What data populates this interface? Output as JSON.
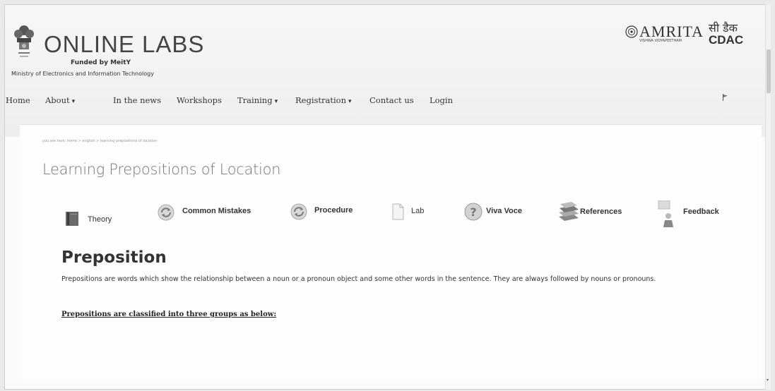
{
  "brand": {
    "title": "ONLINE LABS",
    "funded_by": "Funded by MeitY",
    "ministry": "Ministry of Electronics and Information Technology"
  },
  "partners": {
    "amrita_name": "AMRITA",
    "amrita_sub": "VISHWA VIDYAPEETHAM",
    "cdac_hindi": "सी डैक",
    "cdac_name": "CDAC"
  },
  "nav": [
    {
      "label": "Home",
      "dropdown": false
    },
    {
      "label": "About",
      "dropdown": true
    },
    {
      "label": "In the news",
      "dropdown": false
    },
    {
      "label": "Workshops",
      "dropdown": false
    },
    {
      "label": "Training",
      "dropdown": true
    },
    {
      "label": "Registration",
      "dropdown": true
    },
    {
      "label": "Contact us",
      "dropdown": false
    },
    {
      "label": "Login",
      "dropdown": false
    }
  ],
  "breadcrumb": "you are here: home > english > learning prepositions of location",
  "page_title": "Learning Prepositions of Location",
  "tabs": [
    {
      "label": "Theory",
      "icon": "book-icon"
    },
    {
      "label": "Common Mistakes",
      "icon": "refresh-icon"
    },
    {
      "label": "Procedure",
      "icon": "refresh-icon"
    },
    {
      "label": "Lab",
      "icon": "document-icon"
    },
    {
      "label": "Viva Voce",
      "icon": "question-icon"
    },
    {
      "label": "References",
      "icon": "books-stack-icon"
    },
    {
      "label": "Feedback",
      "icon": "feedback-person-icon"
    }
  ],
  "content": {
    "heading": "Preposition",
    "body": "Prepositions are words which show the relationship between a noun or a pronoun object and some other words in the sentence. They are always followed by nouns or pronouns.",
    "link": "Prepositions are classified into three groups as below:"
  }
}
